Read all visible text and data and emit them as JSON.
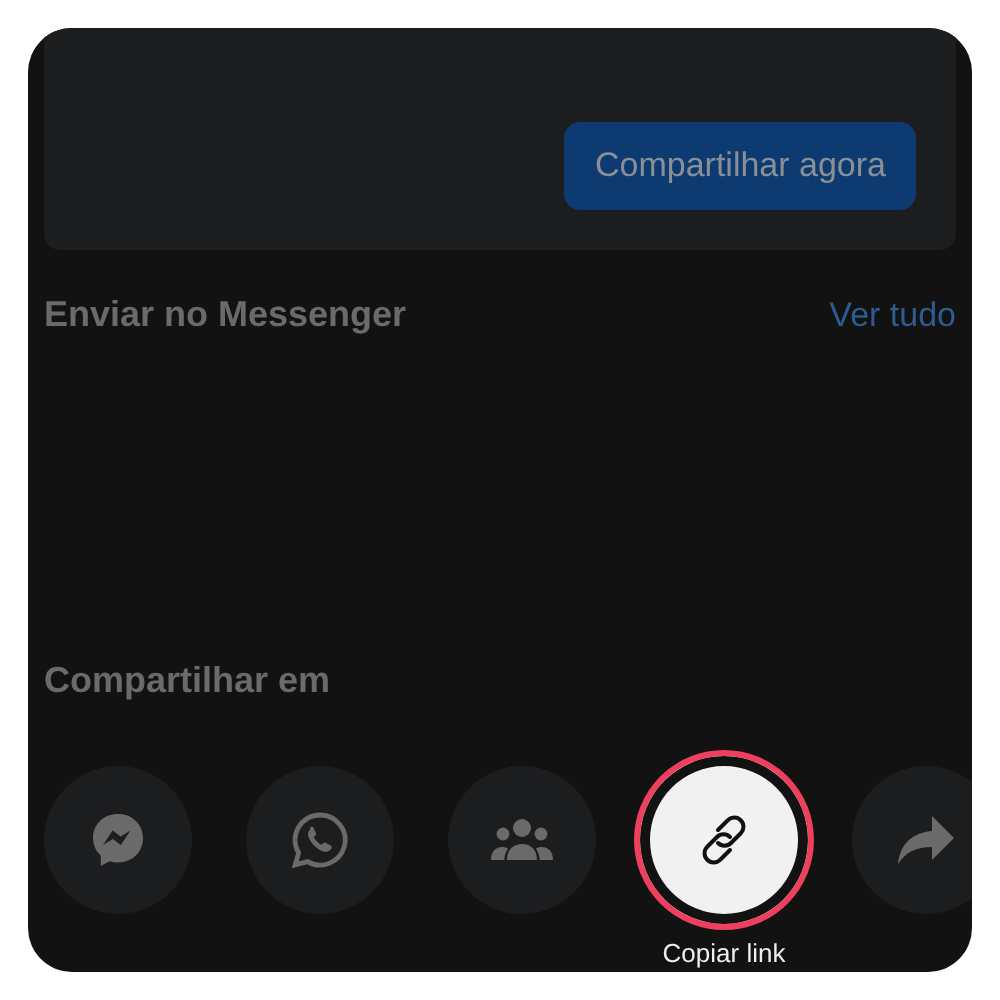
{
  "preview": {
    "button": "Compartilhar agora"
  },
  "messenger": {
    "title": "Enviar no Messenger",
    "link": "Ver tudo"
  },
  "share": {
    "title": "Compartilhar em",
    "targets": [
      {
        "kind": "messenger",
        "selected": false
      },
      {
        "kind": "whatsapp",
        "selected": false
      },
      {
        "kind": "group",
        "selected": false
      },
      {
        "kind": "link",
        "selected": true,
        "label": "Copiar link"
      },
      {
        "kind": "share",
        "selected": false
      }
    ]
  }
}
